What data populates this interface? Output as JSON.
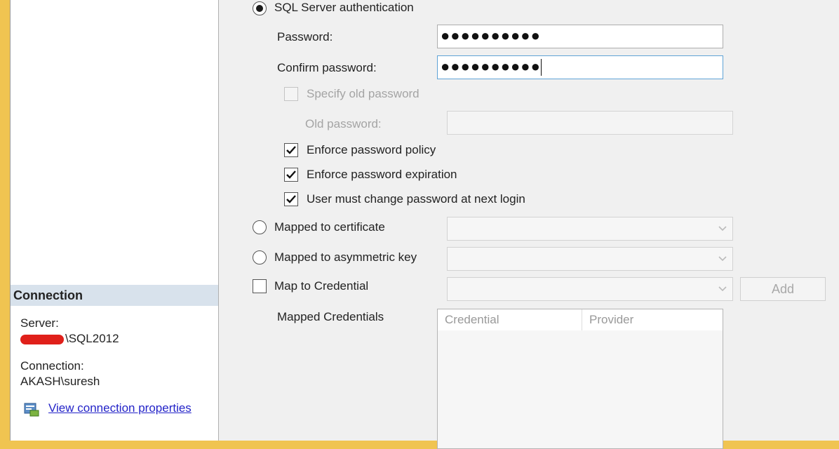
{
  "connection": {
    "header": "Connection",
    "server_label": "Server:",
    "server_value": "\\SQL2012",
    "connection_label": "Connection:",
    "connection_value": "AKASH\\suresh",
    "view_link": "View connection properties"
  },
  "auth": {
    "sql_auth_label": "SQL Server authentication",
    "password_label": "Password:",
    "password_value": "●●●●●●●●●●",
    "confirm_label": "Confirm password:",
    "confirm_value": "●●●●●●●●●●",
    "specify_old_label": "Specify old password",
    "old_password_label": "Old password:",
    "enforce_policy_label": "Enforce password policy",
    "enforce_expiration_label": "Enforce password expiration",
    "must_change_label": "User must change password at next login",
    "mapped_certificate_label": "Mapped to certificate",
    "mapped_asymmetric_label": "Mapped to asymmetric key",
    "map_credential_label": "Map to Credential",
    "add_button": "Add",
    "mapped_credentials_label": "Mapped Credentials",
    "grid_columns": [
      "Credential",
      "Provider"
    ]
  },
  "icons": {
    "connection_properties": "properties-icon"
  }
}
